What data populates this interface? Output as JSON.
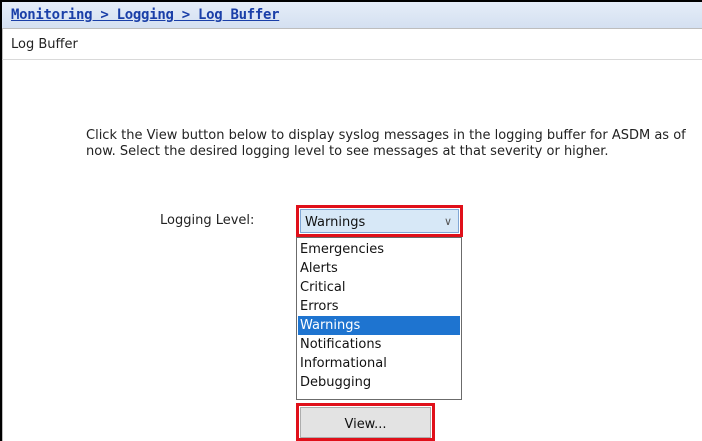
{
  "breadcrumb": {
    "text": "Monitoring > Logging > Log Buffer"
  },
  "panel": {
    "title": "Log Buffer",
    "description": "Click the View button below to display syslog messages in the logging buffer for ASDM as of now. Select the desired logging level to see messages at that severity or higher."
  },
  "logging_level": {
    "label": "Logging Level:",
    "selected": "Warnings",
    "options": [
      "Emergencies",
      "Alerts",
      "Critical",
      "Errors",
      "Warnings",
      "Notifications",
      "Informational",
      "Debugging"
    ]
  },
  "view_button": {
    "label": "View..."
  },
  "icons": {
    "dropdown_arrow": "chevron-down-icon"
  },
  "colors": {
    "highlight_border": "#e0101a",
    "selected_option": "#1e74d0",
    "link": "#1a3fa8"
  }
}
